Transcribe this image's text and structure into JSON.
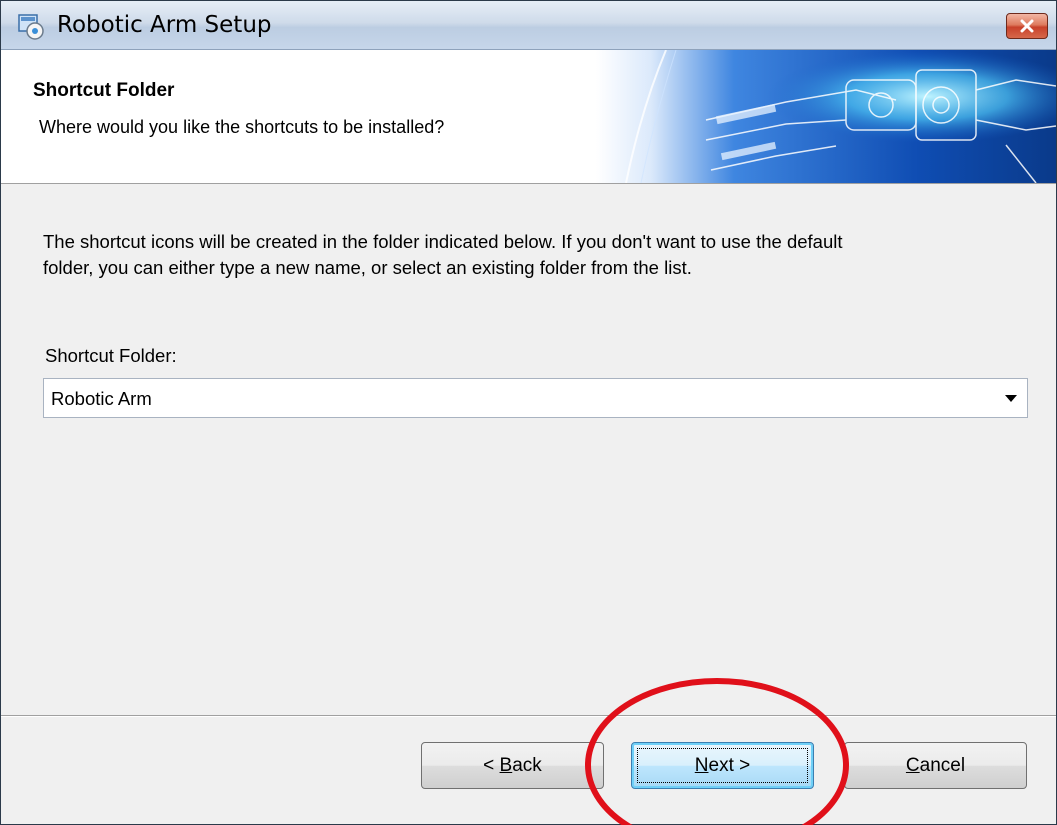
{
  "window": {
    "title": "Robotic Arm Setup",
    "icons": {
      "app": "setup-icon",
      "close": "close-icon"
    }
  },
  "header": {
    "title": "Shortcut Folder",
    "subtitle": "Where would you like the shortcuts to be installed?"
  },
  "body": {
    "description_line1": "The shortcut icons will be created in the folder indicated below. If you don't want to use the default",
    "description_line2": "folder, you can either type a new name, or select an existing folder from the list.",
    "field_label": "Shortcut Folder:",
    "folder_value": "Robotic Arm"
  },
  "buttons": {
    "back": {
      "prefix": "< ",
      "accel": "B",
      "rest": "ack"
    },
    "next": {
      "accel": "N",
      "rest": "ext >"
    },
    "cancel": {
      "accel": "C",
      "rest": "ancel"
    }
  },
  "colors": {
    "annotation": "#e0101a",
    "close_button": "#c8412a",
    "banner_blue": "#1a63c7"
  }
}
